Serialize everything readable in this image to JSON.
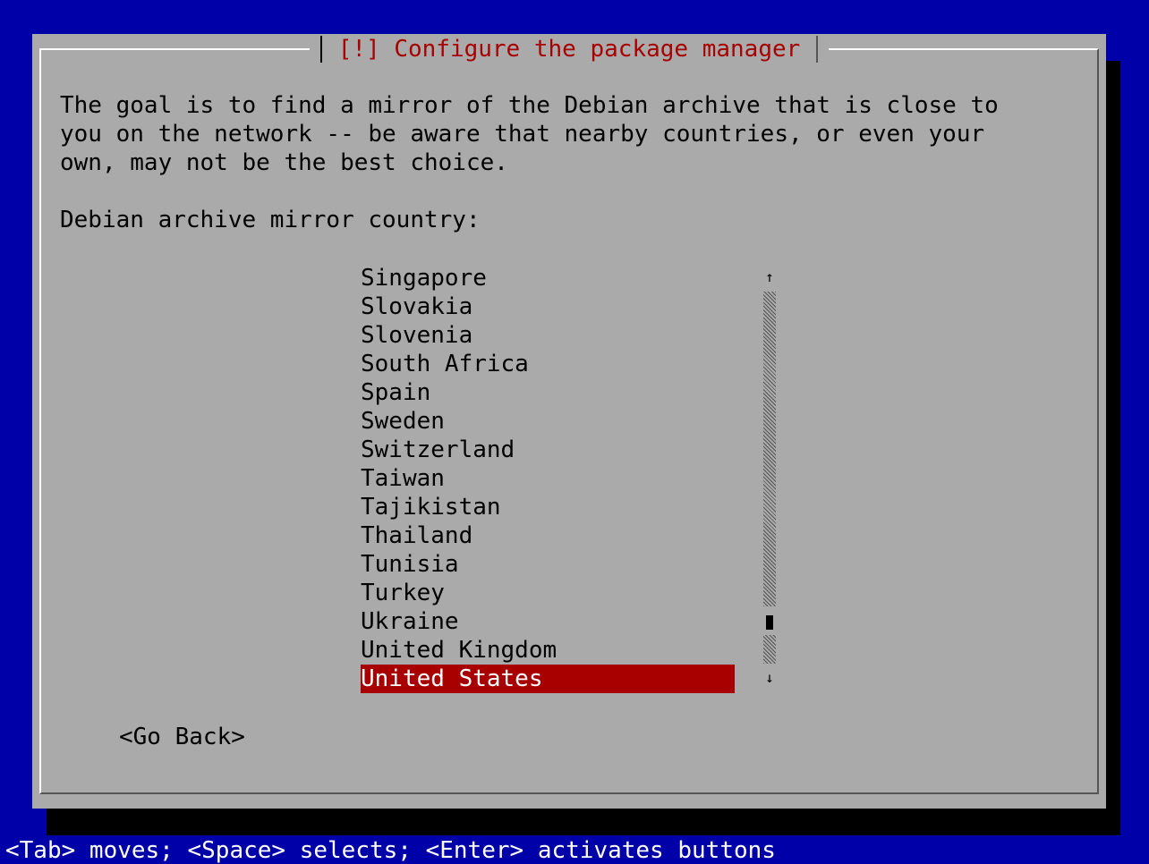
{
  "dialog": {
    "title": "[!] Configure the package manager",
    "description": "The goal is to find a mirror of the Debian archive that is close to\nyou on the network -- be aware that nearby countries, or even your\nown, may not be the best choice.",
    "prompt": "Debian archive mirror country:",
    "countries": [
      "Singapore",
      "Slovakia",
      "Slovenia",
      "South Africa",
      "Spain",
      "Sweden",
      "Switzerland",
      "Taiwan",
      "Tajikistan",
      "Thailand",
      "Tunisia",
      "Turkey",
      "Ukraine",
      "United Kingdom",
      "United States"
    ],
    "selected_country": "United States",
    "go_back_label": "<Go Back>"
  },
  "scrollbar": {
    "up_glyph": "↑",
    "down_glyph": "↓"
  },
  "status_bar": {
    "text": "<Tab> moves; <Space> selects; <Enter> activates buttons"
  },
  "colors": {
    "background": "#0000a8",
    "dialog": "#aaaaaa",
    "title": "#a80000",
    "selection": "#a80000",
    "selection_text": "#ffffff"
  }
}
